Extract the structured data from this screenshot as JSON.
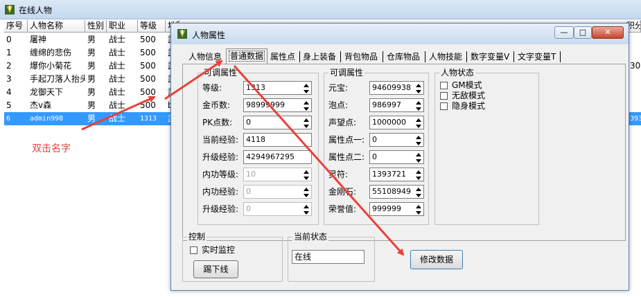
{
  "background_window": {
    "title": "在线人物",
    "columns": [
      "序号",
      "人物名称",
      "性别",
      "职业",
      "等级",
      "地图"
    ],
    "rows": [
      {
        "id": "0",
        "name": "屠神",
        "gender": "男",
        "job": "战士",
        "level": "500",
        "map": "武"
      },
      {
        "id": "1",
        "name": "缠绵的悲伤",
        "gender": "男",
        "job": "战士",
        "level": "500",
        "map": "武"
      },
      {
        "id": "2",
        "name": "爆你小菊花",
        "gender": "男",
        "job": "战士",
        "level": "500",
        "map": "武"
      },
      {
        "id": "3",
        "name": "手起刀落人抬头",
        "gender": "男",
        "job": "战士",
        "level": "500",
        "map": "武"
      },
      {
        "id": "4",
        "name": "龙御天下",
        "gender": "男",
        "job": "战士",
        "level": "500",
        "map": "武"
      },
      {
        "id": "5",
        "name": "杰v森",
        "gender": "男",
        "job": "战士",
        "level": "500",
        "map": "b"
      },
      {
        "id": "6",
        "name": "admin998",
        "gender": "男",
        "job": "战士",
        "level": "1313",
        "map": "武"
      }
    ],
    "right_edge_header": "积分",
    "right_edge_values": {
      "row2": "30",
      "row6": "393"
    }
  },
  "dialog": {
    "title": "人物属性",
    "minimize_label": "—",
    "maximize_label": "□",
    "close_label": "✕",
    "tabs": [
      "人物信息",
      "普通数据",
      "属性点",
      "身上装备",
      "背包物品",
      "仓库物品",
      "人物技能",
      "数字变量V",
      "文字变量T"
    ],
    "active_tab": "普通数据",
    "adjustable_group": {
      "title": "可调属性",
      "fields": [
        {
          "label": "等级:",
          "value": "1313",
          "spin": true,
          "disabled": false
        },
        {
          "label": "金币数:",
          "value": "98999999",
          "spin": true,
          "disabled": false
        },
        {
          "label": "PK点数:",
          "value": "0",
          "spin": true,
          "disabled": false
        },
        {
          "label": "当前经验:",
          "value": "4118",
          "spin": false,
          "disabled": false
        },
        {
          "label": "升级经验:",
          "value": "4294967295",
          "spin": false,
          "disabled": false
        },
        {
          "label": "内功等级:",
          "value": "10",
          "spin": true,
          "disabled": true
        },
        {
          "label": "内功经验:",
          "value": "0",
          "spin": true,
          "disabled": true
        },
        {
          "label": "升级经验:",
          "value": "0",
          "spin": true,
          "disabled": true
        }
      ]
    },
    "adjustable_group2": {
      "title": "可调属性",
      "fields": [
        {
          "label": "元宝:",
          "value": "94609938",
          "spin": true
        },
        {
          "label": "泡点:",
          "value": "986997",
          "spin": true
        },
        {
          "label": "声望点:",
          "value": "1000000",
          "spin": true
        },
        {
          "label": "属性点一:",
          "value": "0",
          "spin": true
        },
        {
          "label": "属性点二:",
          "value": "0",
          "spin": true
        },
        {
          "label": "灵符:",
          "value": "1393721",
          "spin": true
        },
        {
          "label": "金刚石:",
          "value": "55108949",
          "spin": true
        },
        {
          "label": "荣誉值:",
          "value": "999999",
          "spin": true
        }
      ]
    },
    "status_group": {
      "title": "人物状态",
      "options": [
        "GM模式",
        "无敌模式",
        "隐身模式"
      ]
    },
    "control_group": {
      "title": "控制",
      "realtime_label": "实时监控",
      "kick_label": "踢下线"
    },
    "current_state_group": {
      "title": "当前状态",
      "value": "在线"
    },
    "modify_label": "修改数据"
  },
  "annotation": {
    "text": "双击名字",
    "color": "#e8403a"
  }
}
